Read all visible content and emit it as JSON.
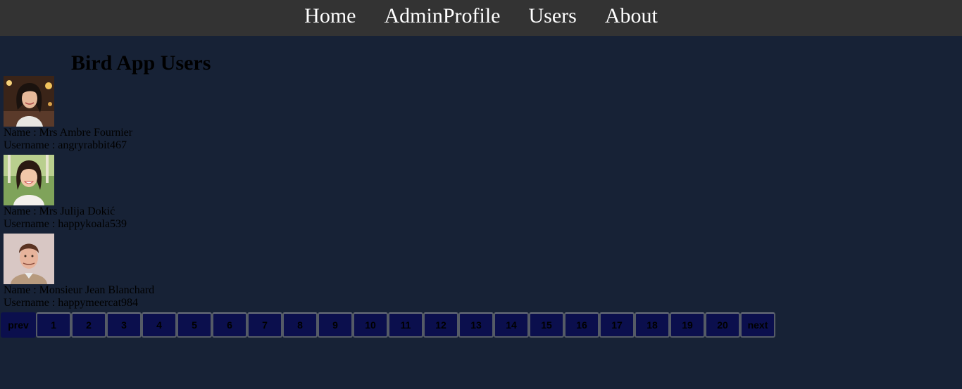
{
  "nav": {
    "items": [
      {
        "label": "Home"
      },
      {
        "label": "AdminProfile"
      },
      {
        "label": "Users"
      },
      {
        "label": "About"
      }
    ]
  },
  "page": {
    "title": "Bird App Users"
  },
  "users": [
    {
      "name_line": "Name : Mrs Ambre Fournier",
      "username_line": "Username : angryrabbit467",
      "avatar": "avatar-photo"
    },
    {
      "name_line": "Name : Mrs Julija Dokić",
      "username_line": "Username : happykoala539",
      "avatar": "avatar-photo"
    },
    {
      "name_line": "Name : Monsieur Jean Blanchard",
      "username_line": "Username : happymeercat984",
      "avatar": "avatar-photo"
    }
  ],
  "pagination": {
    "prev_label": "prev",
    "pages": [
      "1",
      "2",
      "3",
      "4",
      "5",
      "6",
      "7",
      "8",
      "9",
      "10",
      "11",
      "12",
      "13",
      "14",
      "15",
      "16",
      "17",
      "18",
      "19",
      "20"
    ],
    "next_label": "next"
  },
  "colors": {
    "background": "#172236",
    "navbar": "#333333",
    "button": "#0b0f4d"
  }
}
